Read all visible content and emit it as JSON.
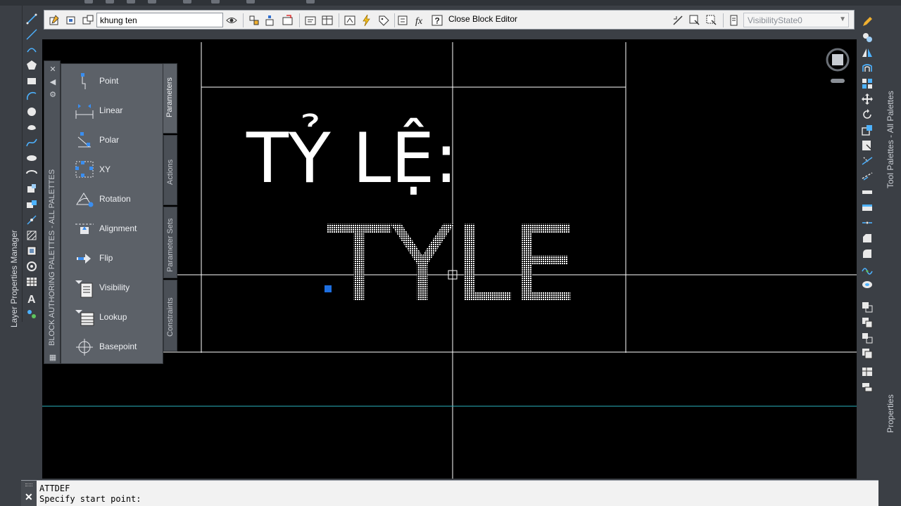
{
  "toolbar": {
    "block_name": "khung ten",
    "close_label": "Close Block Editor",
    "visibility_state": "VisibilityState0"
  },
  "left_strip": {
    "title": "Layer Properties Manager"
  },
  "right_strip": {
    "tool_palettes_label": "Tool Palettes - All Palettes",
    "properties_label": "Properties"
  },
  "palette": {
    "title": "BLOCK AUTHORING PALETTES - ALL PALETTES",
    "items": [
      {
        "label": "Point",
        "icon": "point-parameter-icon"
      },
      {
        "label": "Linear",
        "icon": "linear-parameter-icon"
      },
      {
        "label": "Polar",
        "icon": "polar-parameter-icon"
      },
      {
        "label": "XY",
        "icon": "xy-parameter-icon"
      },
      {
        "label": "Rotation",
        "icon": "rotation-parameter-icon"
      },
      {
        "label": "Alignment",
        "icon": "alignment-parameter-icon"
      },
      {
        "label": "Flip",
        "icon": "flip-parameter-icon"
      },
      {
        "label": "Visibility",
        "icon": "visibility-parameter-icon"
      },
      {
        "label": "Lookup",
        "icon": "lookup-parameter-icon"
      },
      {
        "label": "Basepoint",
        "icon": "basepoint-parameter-icon"
      }
    ],
    "tabs": [
      "Parameters",
      "Actions",
      "Parameter Sets",
      "Constraints"
    ]
  },
  "drawing": {
    "label_text": "TỶ LỆ:",
    "attribute_tag": "TYLE"
  },
  "command": {
    "line1": "ATTDEF",
    "line2": "Specify start point:"
  },
  "colors": {
    "canvas_bg": "#000000",
    "accent_cyan": "#2ab3c0",
    "grip_blue": "#1e6fe0"
  }
}
